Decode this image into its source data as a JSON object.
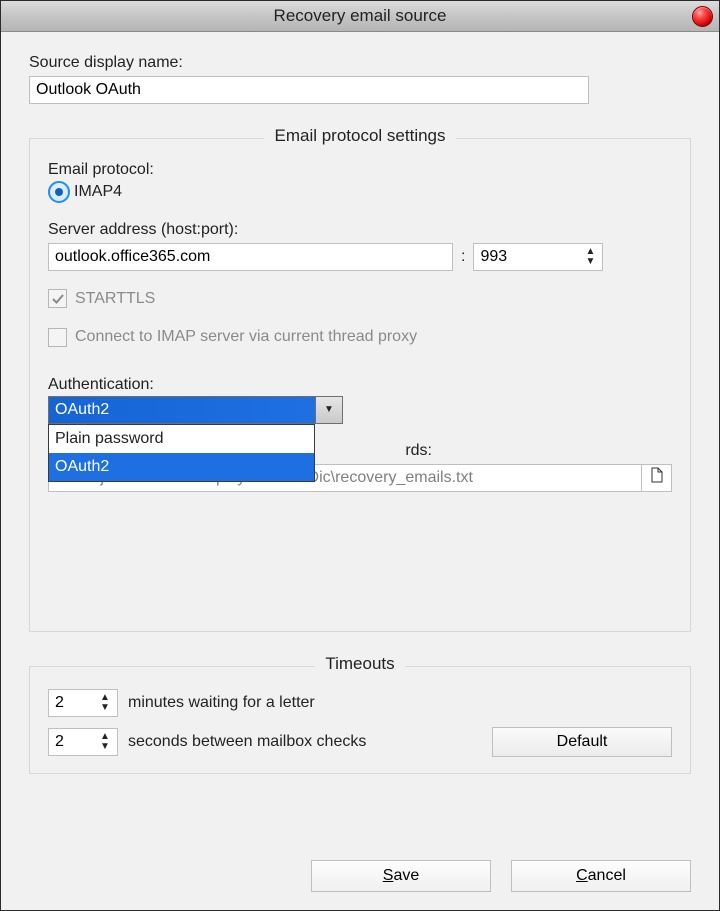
{
  "window": {
    "title": "Recovery email source"
  },
  "source": {
    "label": "Source display name:",
    "value": "Outlook OAuth"
  },
  "protocol_group": {
    "legend": "Email protocol settings",
    "protocol_label": "Email protocol:",
    "protocol_value": "IMAP4",
    "server_label": "Server address (host:port):",
    "server_host": "outlook.office365.com",
    "server_port": "993",
    "starttls_label": "STARTTLS",
    "thread_proxy_label": "Connect to IMAP server via current thread proxy",
    "auth_label": "Authentication:",
    "auth_selected": "OAuth2",
    "auth_options": [
      "Plain password",
      "OAuth2"
    ],
    "file_label_fragment": "rds:",
    "file_value": "C:\\Projects\\MailBot\\Deploy\\MailBot\\Dic\\recovery_emails.txt"
  },
  "timeouts": {
    "legend": "Timeouts",
    "wait_minutes": "2",
    "wait_minutes_label": "minutes waiting for a letter",
    "check_seconds": "2",
    "check_seconds_label": "seconds between mailbox checks",
    "default_label": "Default"
  },
  "buttons": {
    "save_letter": "S",
    "save_rest": "ave",
    "cancel_letter": "C",
    "cancel_rest": "ancel"
  }
}
